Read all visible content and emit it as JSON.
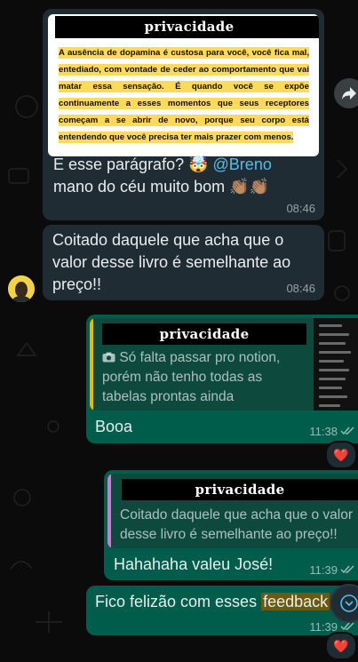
{
  "messages": {
    "m1": {
      "privacy_label": "privacidade",
      "image_text": "A ausência de dopamina é custosa para você, você fica mal, entediado, com vontade de ceder ao comportamento que vai matar essa sensação. É quando você se expõe continuamente a esses momentos que seus receptores começam a se abrir de novo, porque seu corpo está entendendo que você precisa ter mais prazer com menos.",
      "text_line1": "E esse parágrafo? ",
      "emoji": "🤯",
      "mention": " @Breno",
      "text_line2": "mano do céu muito bom ",
      "emoji2": "👏🏽👏🏽",
      "time": "08:46"
    },
    "m2": {
      "text": "Coitado daquele que acha que o valor desse livro é semelhante ao preço!!",
      "time": "08:46"
    },
    "m3": {
      "privacy_label": "privacidade",
      "quote_text": "Só falta passar pro notion, porém não tenho todas as tabelas prontas ainda",
      "quote_icon": "camera-icon",
      "text": "Booa",
      "time": "11:38",
      "reaction": "❤️"
    },
    "m4": {
      "privacy_label": "privacidade",
      "quote_text": "Coitado daquele que acha que o valor desse livro é semelhante ao preço!!",
      "text": "Hahahaha valeu José!",
      "time": "11:39"
    },
    "m5": {
      "text_before": "Fico felizão com esses ",
      "highlight": "feedback",
      "time": "11:39",
      "reaction": "❤️"
    }
  },
  "colors": {
    "incoming": "#1f2c34",
    "outgoing": "#005c4b",
    "quote_bar_yellow": "#e6b800",
    "quote_bar_pink": "#c57fd8",
    "mention": "#53bdeb",
    "highlight": "#ffd95a"
  },
  "icons": [
    "forward-icon",
    "camera-icon",
    "read-ticks-icon",
    "chevron-down-icon"
  ]
}
